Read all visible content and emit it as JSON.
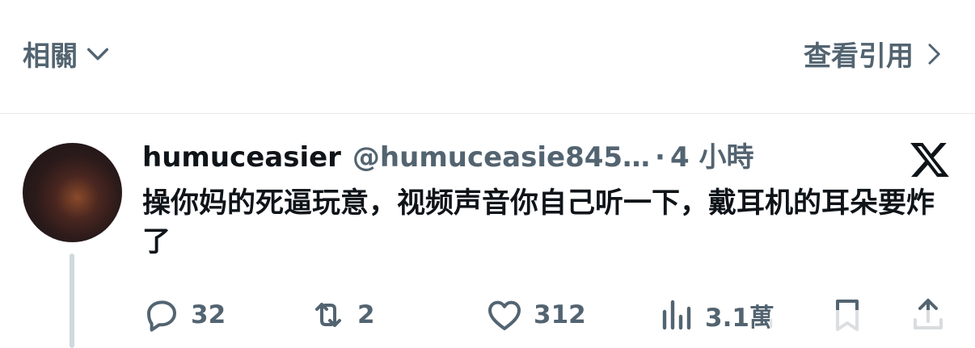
{
  "top_bar": {
    "related_label": "相關",
    "view_quotes_label": "查看引用"
  },
  "tweet": {
    "username": "humuceasier",
    "handle": "@humuceasie845…",
    "separator": "·",
    "time": "4 小時",
    "text": "操你妈的死逼玩意，视频声音你自己听一下，戴耳机的耳朵要炸了",
    "stats": {
      "replies": "32",
      "retweets": "2",
      "likes": "312",
      "views": "3.1萬"
    }
  },
  "colors": {
    "text_primary": "#0f1419",
    "text_secondary": "#536471",
    "divider": "#e7e9ea",
    "thread_line": "#cfd9de"
  },
  "icons": [
    "chevron-down-icon",
    "chevron-right-icon",
    "x-logo-icon",
    "reply-icon",
    "retweet-icon",
    "like-icon",
    "views-icon",
    "bookmark-icon",
    "share-icon"
  ]
}
